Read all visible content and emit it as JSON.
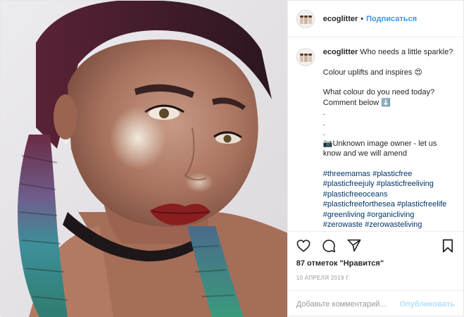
{
  "post": {
    "username": "ecoglitter",
    "follow_label": "Подписаться",
    "dot": "•",
    "caption": {
      "lines": [
        "Who needs a little sparkle?",
        "Colour uplifts and inspires 😍",
        "What colour do you need today? Comment below ⬇️",
        ".",
        ".",
        ".",
        "📷Unknown image owner - let us know and we will amend"
      ],
      "hashtags": "#threemamas #plasticfree #plasticfreejuly #plasticfreeliving #plasticfreeoceans #plasticfreeforthesea #plasticfreelife #greenliving #organicliving #zerowaste #zerowasteliving"
    },
    "likes": "87 отметок \"Нравится\"",
    "date": "10 АПРЕЛЯ 2019 Г.",
    "comment_placeholder": "Добавьте комментарий...",
    "publish_label": "Опубликовать"
  },
  "icons": [
    "heart-icon",
    "comment-icon",
    "share-icon",
    "bookmark-icon"
  ],
  "colors": {
    "link": "#3897f0",
    "hashtag": "#003569",
    "publish_disabled": "#b2dffc",
    "muted": "#999999"
  }
}
